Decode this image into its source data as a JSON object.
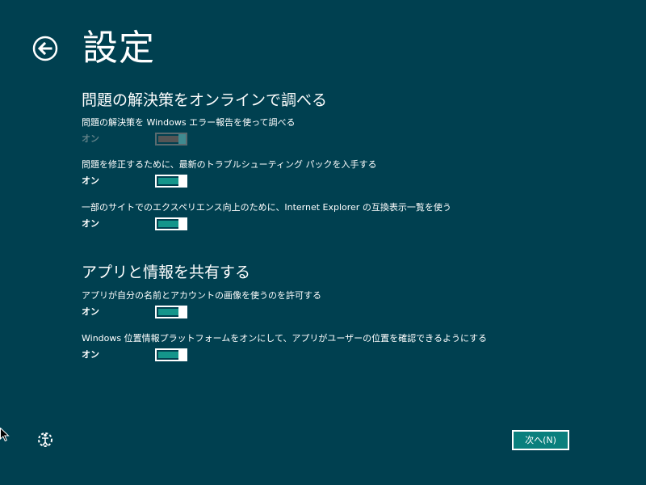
{
  "page": {
    "title": "設定"
  },
  "sections": [
    {
      "heading": "問題の解決策をオンラインで調べる",
      "settings": [
        {
          "label": "問題の解決策を Windows エラー報告を使って調べる",
          "state": "オン",
          "on": true,
          "enabled": false
        },
        {
          "label": "問題を修正するために、最新のトラブルシューティング パックを入手する",
          "state": "オン",
          "on": true,
          "enabled": true
        },
        {
          "label": "一部のサイトでのエクスペリエンス向上のために、Internet Explorer の互換表示一覧を使う",
          "state": "オン",
          "on": true,
          "enabled": true
        }
      ]
    },
    {
      "heading": "アプリと情報を共有する",
      "settings": [
        {
          "label": "アプリが自分の名前とアカウントの画像を使うのを許可する",
          "state": "オン",
          "on": true,
          "enabled": true
        },
        {
          "label": "Windows 位置情報プラットフォームをオンにして、アプリがユーザーの位置を確認できるようにする",
          "state": "オン",
          "on": true,
          "enabled": true
        }
      ]
    }
  ],
  "footer": {
    "next_label": "次へ(N)",
    "accessibility_icon": "ease-of-access-icon"
  },
  "navigation": {
    "back_icon": "back-arrow-icon"
  },
  "colors": {
    "background": "#004050",
    "accent": "#14958b",
    "disabled_track": "#555555"
  }
}
